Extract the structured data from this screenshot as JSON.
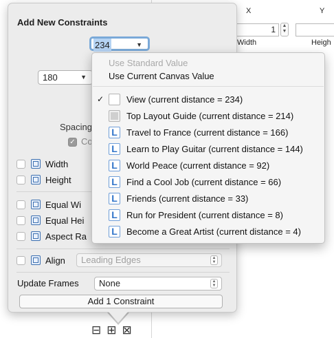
{
  "background": {
    "col_x": "X",
    "col_y": "Y",
    "x_value": "1",
    "width_label": "Width",
    "height_label": "Heigh"
  },
  "popover": {
    "title": "Add New Constraints",
    "top_value": "234",
    "left_value": "180",
    "spacing_label": "Spacing",
    "constrain_margins_label": "Co",
    "width_label": "Width",
    "height_label": "Height",
    "equal_widths_label": "Equal Wi",
    "equal_heights_label": "Equal Hei",
    "aspect_ratio_label": "Aspect Ra",
    "align_label": "Align",
    "align_value": "Leading Edges",
    "update_frames_label": "Update Frames",
    "update_frames_value": "None",
    "add_button_label": "Add 1 Constraint"
  },
  "menu": {
    "header_items": [
      "Use Standard Value",
      "Use Current Canvas Value"
    ],
    "items": [
      {
        "label": "View (current distance = 234)",
        "checked": true,
        "icon": "view-icon"
      },
      {
        "label": "Top Layout Guide (current distance = 214)",
        "checked": false,
        "icon": "layout-guide-icon"
      },
      {
        "label": "Travel to France (current distance = 166)",
        "checked": false,
        "icon": "label-icon"
      },
      {
        "label": "Learn to Play Guitar (current distance = 144)",
        "checked": false,
        "icon": "label-icon"
      },
      {
        "label": "World Peace (current distance = 92)",
        "checked": false,
        "icon": "label-icon"
      },
      {
        "label": "Find a Cool Job (current distance = 66)",
        "checked": false,
        "icon": "label-icon"
      },
      {
        "label": "Friends (current distance = 33)",
        "checked": false,
        "icon": "label-icon"
      },
      {
        "label": "Run for President (current distance = 8)",
        "checked": false,
        "icon": "label-icon"
      },
      {
        "label": "Become a Great Artist (current distance = 4)",
        "checked": false,
        "icon": "label-icon"
      }
    ],
    "check_glyph": "✓",
    "label_icon_glyph": "L"
  },
  "colors": {
    "accent": "#2f73c9",
    "focus_ring": "#7aa9d8",
    "selection": "#b5d3f3"
  }
}
